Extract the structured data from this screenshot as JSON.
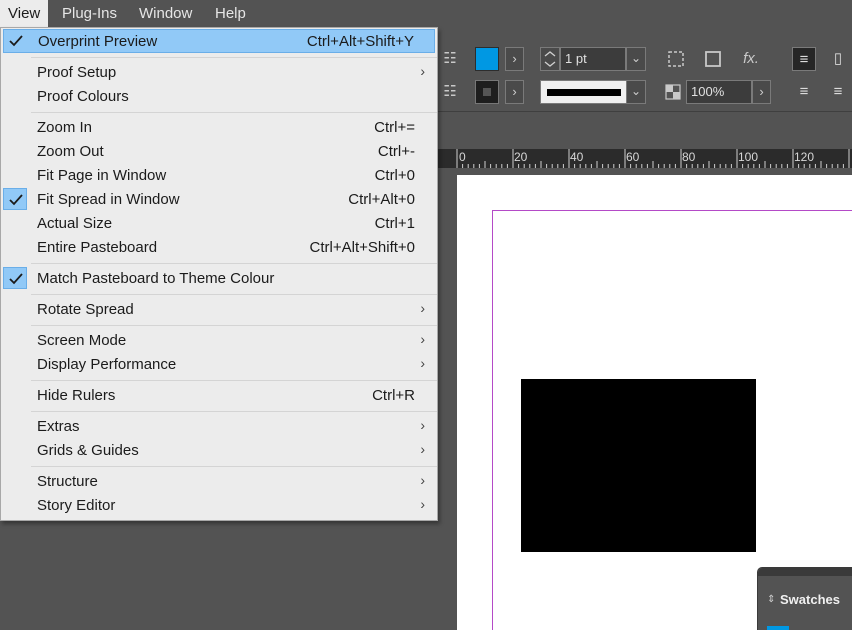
{
  "menubar": {
    "items": [
      {
        "label": "View"
      },
      {
        "label": "Plug-Ins"
      },
      {
        "label": "Window"
      },
      {
        "label": "Help"
      }
    ]
  },
  "control_panel": {
    "stroke_weight": "1 pt",
    "opacity": "100%",
    "fill_color": "#0098e3",
    "stroke_color": "#1e1e1e"
  },
  "ruler": {
    "labels": [
      "0",
      "20",
      "40",
      "60",
      "80",
      "100",
      "120"
    ]
  },
  "swatches_panel": {
    "title": "Swatches"
  },
  "view_menu": {
    "items": [
      {
        "label": "Overprint Preview",
        "shortcut": "Ctrl+Alt+Shift+Y",
        "checked": true,
        "highlighted": true
      },
      {
        "label": "Proof Setup",
        "submenu": true
      },
      {
        "label": "Proof Colours"
      },
      {
        "label": "Zoom In",
        "shortcut": "Ctrl+="
      },
      {
        "label": "Zoom Out",
        "shortcut": "Ctrl+-"
      },
      {
        "label": "Fit Page in Window",
        "shortcut": "Ctrl+0"
      },
      {
        "label": "Fit Spread in Window",
        "shortcut": "Ctrl+Alt+0",
        "checked": true
      },
      {
        "label": "Actual Size",
        "shortcut": "Ctrl+1"
      },
      {
        "label": "Entire Pasteboard",
        "shortcut": "Ctrl+Alt+Shift+0"
      },
      {
        "label": "Match Pasteboard to Theme Colour",
        "checked": true
      },
      {
        "label": "Rotate Spread",
        "submenu": true
      },
      {
        "label": "Screen Mode",
        "submenu": true
      },
      {
        "label": "Display Performance",
        "submenu": true
      },
      {
        "label": "Hide Rulers",
        "shortcut": "Ctrl+R"
      },
      {
        "label": "Extras",
        "submenu": true
      },
      {
        "label": "Grids & Guides",
        "submenu": true
      },
      {
        "label": "Structure",
        "submenu": true
      },
      {
        "label": "Story Editor",
        "submenu": true
      }
    ]
  }
}
